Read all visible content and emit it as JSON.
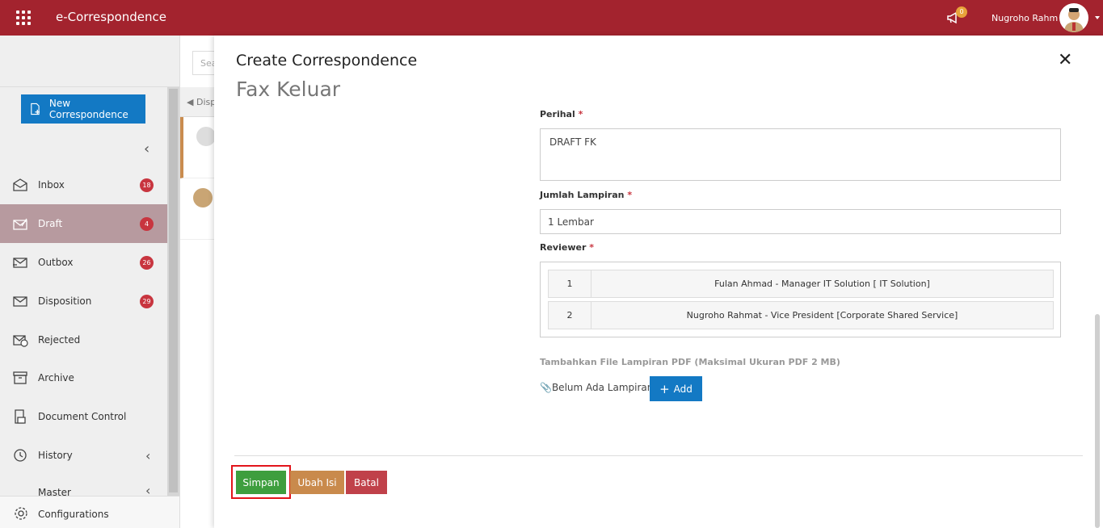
{
  "header": {
    "app_title": "e-Correspondence",
    "notification_count": "0",
    "user_name": "Nugroho Rahm"
  },
  "sidebar": {
    "new_button_label": "New Correspondence",
    "items": [
      {
        "label": "Inbox",
        "badge": "18"
      },
      {
        "label": "Draft",
        "badge": "4"
      },
      {
        "label": "Outbox",
        "badge": "26"
      },
      {
        "label": "Disposition",
        "badge": "29"
      },
      {
        "label": "Rejected"
      },
      {
        "label": "Archive"
      },
      {
        "label": "Document Control"
      },
      {
        "label": "History"
      },
      {
        "label": "Master"
      }
    ],
    "configurations_label": "Configurations"
  },
  "middle": {
    "search_placeholder": "Sea",
    "disposition_tab": "Disp"
  },
  "modal": {
    "title": "Create Correspondence",
    "subtitle": "Fax Keluar",
    "perihal_label": "Perihal",
    "perihal_value": "DRAFT FK",
    "jumlah_label": "Jumlah Lampiran",
    "jumlah_value": "1 Lembar",
    "reviewer_label": "Reviewer",
    "reviewers": [
      {
        "no": "1",
        "name": "Fulan Ahmad - Manager IT Solution [ IT Solution]"
      },
      {
        "no": "2",
        "name": "Nugroho Rahmat - Vice President [Corporate Shared Service]"
      }
    ],
    "attach_hint": "Tambahkan File Lampiran PDF (Maksimal Ukuran PDF 2 MB)",
    "attach_none": "Belum Ada Lampiran -",
    "add_label": "Add",
    "save_label": "Simpan",
    "edit_label": "Ubah Isi",
    "cancel_label": "Batal",
    "required_mark": "*"
  }
}
